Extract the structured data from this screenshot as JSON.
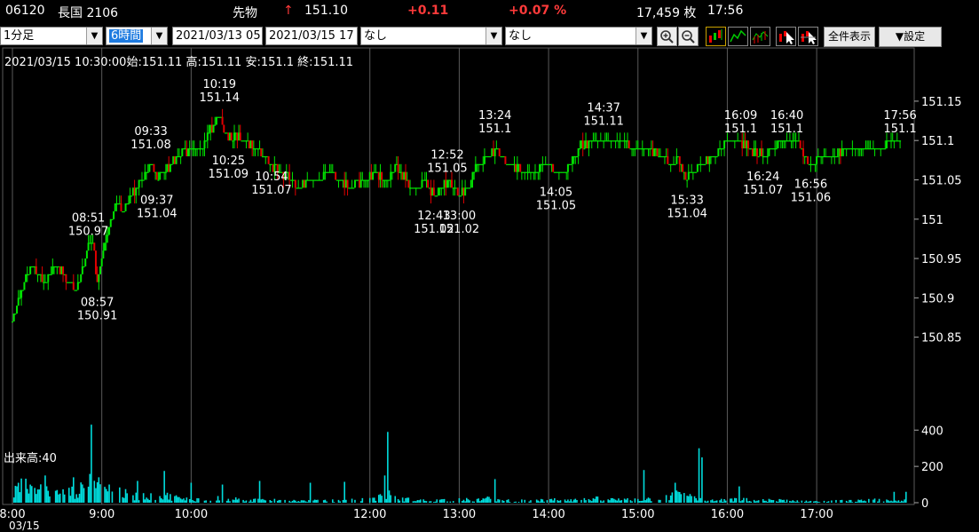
{
  "header": {
    "code": "06120",
    "name": "長国 2106",
    "type": "先物",
    "arrow": "↑",
    "price": "151.10",
    "change": "+0.11",
    "change_pct": "+0.07 %",
    "volume": "17,459 枚",
    "time": "17:56"
  },
  "toolbar": {
    "interval": "1分足",
    "span": "6時間",
    "from": "2021/03/13 05",
    "to": "2021/03/15 17",
    "indicator1": "なし",
    "indicator2": "なし",
    "zoom_in_icon": "zoom-in-icon",
    "zoom_out_icon": "zoom-out-icon",
    "show_all": "全件表示",
    "settings": "▼設定"
  },
  "info_line": "2021/03/15 10:30:00始:151.11 高:151.11 安:151.1 終:151.11",
  "volume_label": "出来高:40",
  "date_fragment": "03/15",
  "colors": {
    "up": "#00e600",
    "down": "#e00000",
    "volume": "#00dcdc",
    "grid": "#5a5a5a",
    "background": "#000000"
  },
  "chart_data": {
    "type": "candlestick",
    "price_axis": {
      "ticks": [
        150.85,
        150.9,
        150.95,
        151,
        151.05,
        151.1,
        151.15
      ],
      "tick_labels": [
        "150.85",
        "150.9",
        "150.95",
        "151",
        "151.05",
        "151.1",
        "151.15"
      ]
    },
    "volume_axis": {
      "ticks": [
        0,
        200,
        400
      ],
      "tick_labels": [
        "0",
        "200",
        "400"
      ]
    },
    "x_ticks": [
      "8:00",
      "9:00",
      "10:00",
      "12:00",
      "13:00",
      "14:00",
      "15:00",
      "16:00",
      "17:00"
    ],
    "x_ticks_min": [
      0,
      60,
      120,
      240,
      300,
      360,
      420,
      480,
      540
    ],
    "annotations": [
      {
        "t": 51,
        "p": 150.97,
        "time": "08:51",
        "price": "150.97",
        "pos": "above"
      },
      {
        "t": 57,
        "p": 150.91,
        "time": "08:57",
        "price": "150.91",
        "pos": "below"
      },
      {
        "t": 93,
        "p": 151.08,
        "time": "09:33",
        "price": "151.08",
        "pos": "above"
      },
      {
        "t": 97,
        "p": 151.04,
        "time": "09:37",
        "price": "151.04",
        "pos": "below"
      },
      {
        "t": 139,
        "p": 151.14,
        "time": "10:19",
        "price": "151.14",
        "pos": "above"
      },
      {
        "t": 145,
        "p": 151.09,
        "time": "10:25",
        "price": "151.09",
        "pos": "below"
      },
      {
        "t": 174,
        "p": 151.07,
        "time": "10:54",
        "price": "151.07",
        "pos": "below"
      },
      {
        "t": 283,
        "p": 151.02,
        "time": "12:43",
        "price": "151.02",
        "pos": "below"
      },
      {
        "t": 292,
        "p": 151.05,
        "time": "12:52",
        "price": "151.05",
        "pos": "above"
      },
      {
        "t": 300,
        "p": 151.02,
        "time": "13:00",
        "price": "151.02",
        "pos": "below"
      },
      {
        "t": 324,
        "p": 151.1,
        "time": "13:24",
        "price": "151.1",
        "pos": "above"
      },
      {
        "t": 365,
        "p": 151.05,
        "time": "14:05",
        "price": "151.05",
        "pos": "below"
      },
      {
        "t": 397,
        "p": 151.11,
        "time": "14:37",
        "price": "151.11",
        "pos": "above"
      },
      {
        "t": 453,
        "p": 151.04,
        "time": "15:33",
        "price": "151.04",
        "pos": "below"
      },
      {
        "t": 489,
        "p": 151.1,
        "time": "16:09",
        "price": "151.1",
        "pos": "above"
      },
      {
        "t": 504,
        "p": 151.07,
        "time": "16:24",
        "price": "151.07",
        "pos": "below"
      },
      {
        "t": 520,
        "p": 151.1,
        "time": "16:40",
        "price": "151.1",
        "pos": "above"
      },
      {
        "t": 536,
        "p": 151.06,
        "time": "16:56",
        "price": "151.06",
        "pos": "below"
      },
      {
        "t": 596,
        "p": 151.1,
        "time": "17:56",
        "price": "151.1",
        "pos": "above"
      }
    ],
    "price_anchors": [
      [
        0,
        150.87
      ],
      [
        5,
        150.9
      ],
      [
        10,
        150.93
      ],
      [
        14,
        150.94
      ],
      [
        20,
        150.92
      ],
      [
        26,
        150.93
      ],
      [
        30,
        150.94
      ],
      [
        34,
        150.93
      ],
      [
        38,
        150.92
      ],
      [
        42,
        150.91
      ],
      [
        46,
        150.93
      ],
      [
        50,
        150.96
      ],
      [
        51,
        150.97
      ],
      [
        54,
        150.97
      ],
      [
        57,
        150.92
      ],
      [
        61,
        150.96
      ],
      [
        65,
        150.99
      ],
      [
        70,
        151.02
      ],
      [
        75,
        151.01
      ],
      [
        80,
        151.03
      ],
      [
        86,
        151.05
      ],
      [
        90,
        151.06
      ],
      [
        93,
        151.07
      ],
      [
        97,
        151.05
      ],
      [
        101,
        151.06
      ],
      [
        106,
        151.07
      ],
      [
        112,
        151.08
      ],
      [
        118,
        151.09
      ],
      [
        126,
        151.09
      ],
      [
        132,
        151.11
      ],
      [
        139,
        151.13
      ],
      [
        145,
        151.1
      ],
      [
        150,
        151.11
      ],
      [
        156,
        151.1
      ],
      [
        162,
        151.09
      ],
      [
        168,
        151.08
      ],
      [
        174,
        151.07
      ],
      [
        180,
        151.06
      ],
      [
        186,
        151.05
      ],
      [
        192,
        151.04
      ],
      [
        198,
        151.05
      ],
      [
        205,
        151.05
      ],
      [
        212,
        151.06
      ],
      [
        220,
        151.05
      ],
      [
        228,
        151.04
      ],
      [
        236,
        151.05
      ],
      [
        244,
        151.06
      ],
      [
        252,
        151.05
      ],
      [
        258,
        151.07
      ],
      [
        264,
        151.05
      ],
      [
        270,
        151.04
      ],
      [
        276,
        151.05
      ],
      [
        283,
        151.03
      ],
      [
        288,
        151.04
      ],
      [
        292,
        151.05
      ],
      [
        296,
        151.04
      ],
      [
        300,
        151.03
      ],
      [
        306,
        151.04
      ],
      [
        312,
        151.07
      ],
      [
        318,
        151.08
      ],
      [
        324,
        151.09
      ],
      [
        330,
        151.08
      ],
      [
        336,
        151.07
      ],
      [
        342,
        151.06
      ],
      [
        350,
        151.06
      ],
      [
        358,
        151.07
      ],
      [
        365,
        151.06
      ],
      [
        372,
        151.06
      ],
      [
        380,
        151.09
      ],
      [
        388,
        151.1
      ],
      [
        397,
        151.1
      ],
      [
        404,
        151.1
      ],
      [
        412,
        151.1
      ],
      [
        420,
        151.09
      ],
      [
        428,
        151.09
      ],
      [
        436,
        151.08
      ],
      [
        442,
        151.07
      ],
      [
        447,
        151.08
      ],
      [
        453,
        151.05
      ],
      [
        458,
        151.06
      ],
      [
        464,
        151.07
      ],
      [
        470,
        151.08
      ],
      [
        476,
        151.09
      ],
      [
        482,
        151.1
      ],
      [
        489,
        151.1
      ],
      [
        496,
        151.09
      ],
      [
        504,
        151.08
      ],
      [
        510,
        151.09
      ],
      [
        516,
        151.1
      ],
      [
        520,
        151.1
      ],
      [
        526,
        151.1
      ],
      [
        532,
        151.08
      ],
      [
        536,
        151.07
      ],
      [
        544,
        151.08
      ],
      [
        552,
        151.08
      ],
      [
        560,
        151.09
      ],
      [
        570,
        151.09
      ],
      [
        580,
        151.09
      ],
      [
        588,
        151.1
      ],
      [
        596,
        151.1
      ]
    ],
    "volume_anchors": [
      [
        0,
        0.2
      ],
      [
        4,
        0.45
      ],
      [
        8,
        0.55
      ],
      [
        12,
        0.35
      ],
      [
        18,
        0.4
      ],
      [
        24,
        0.35
      ],
      [
        28,
        0.3
      ],
      [
        32,
        0.25
      ],
      [
        38,
        0.3
      ],
      [
        45,
        0.35
      ],
      [
        50,
        0.5
      ],
      [
        53,
        1.0
      ],
      [
        57,
        0.6
      ],
      [
        62,
        0.5
      ],
      [
        66,
        0.4
      ],
      [
        70,
        0.3
      ],
      [
        76,
        0.25
      ],
      [
        82,
        0.2
      ],
      [
        90,
        0.2
      ],
      [
        96,
        0.15
      ],
      [
        104,
        0.2
      ],
      [
        110,
        0.15
      ],
      [
        118,
        0.1
      ],
      [
        126,
        0.1
      ],
      [
        132,
        0.12
      ],
      [
        140,
        0.15
      ],
      [
        150,
        0.1
      ],
      [
        160,
        0.08
      ],
      [
        170,
        0.1
      ],
      [
        180,
        0.08
      ],
      [
        190,
        0.06
      ],
      [
        200,
        0.05
      ],
      [
        210,
        0.08
      ],
      [
        220,
        0.05
      ],
      [
        230,
        0.08
      ],
      [
        240,
        0.1
      ],
      [
        246,
        0.15
      ],
      [
        252,
        0.25
      ],
      [
        260,
        0.12
      ],
      [
        270,
        0.08
      ],
      [
        280,
        0.06
      ],
      [
        290,
        0.08
      ],
      [
        300,
        0.1
      ],
      [
        310,
        0.08
      ],
      [
        320,
        0.12
      ],
      [
        330,
        0.08
      ],
      [
        340,
        0.06
      ],
      [
        350,
        0.06
      ],
      [
        360,
        0.08
      ],
      [
        370,
        0.1
      ],
      [
        380,
        0.08
      ],
      [
        390,
        0.12
      ],
      [
        400,
        0.1
      ],
      [
        410,
        0.08
      ],
      [
        420,
        0.1
      ],
      [
        430,
        0.12
      ],
      [
        440,
        0.15
      ],
      [
        448,
        0.3
      ],
      [
        454,
        0.2
      ],
      [
        460,
        0.1
      ],
      [
        470,
        0.06
      ],
      [
        480,
        0.08
      ],
      [
        490,
        0.1
      ],
      [
        500,
        0.06
      ],
      [
        510,
        0.08
      ],
      [
        520,
        0.06
      ],
      [
        530,
        0.05
      ],
      [
        540,
        0.05
      ],
      [
        550,
        0.06
      ],
      [
        560,
        0.05
      ],
      [
        570,
        0.06
      ],
      [
        580,
        0.08
      ],
      [
        590,
        0.06
      ],
      [
        596,
        0.06
      ]
    ],
    "volume_spikes": [
      [
        22,
        150
      ],
      [
        41,
        140
      ],
      [
        53,
        430
      ],
      [
        58,
        140
      ],
      [
        84,
        120
      ],
      [
        102,
        175
      ],
      [
        120,
        110
      ],
      [
        141,
        100
      ],
      [
        166,
        120
      ],
      [
        200,
        110
      ],
      [
        223,
        115
      ],
      [
        250,
        150
      ],
      [
        252,
        390
      ],
      [
        324,
        130
      ],
      [
        424,
        180
      ],
      [
        445,
        110
      ],
      [
        461,
        300
      ],
      [
        463,
        250
      ],
      [
        488,
        90
      ],
      [
        592,
        60
      ],
      [
        600,
        60
      ]
    ],
    "y_range": [
      150.827,
      151.177
    ],
    "volume_range": [
      0,
      460
    ]
  }
}
